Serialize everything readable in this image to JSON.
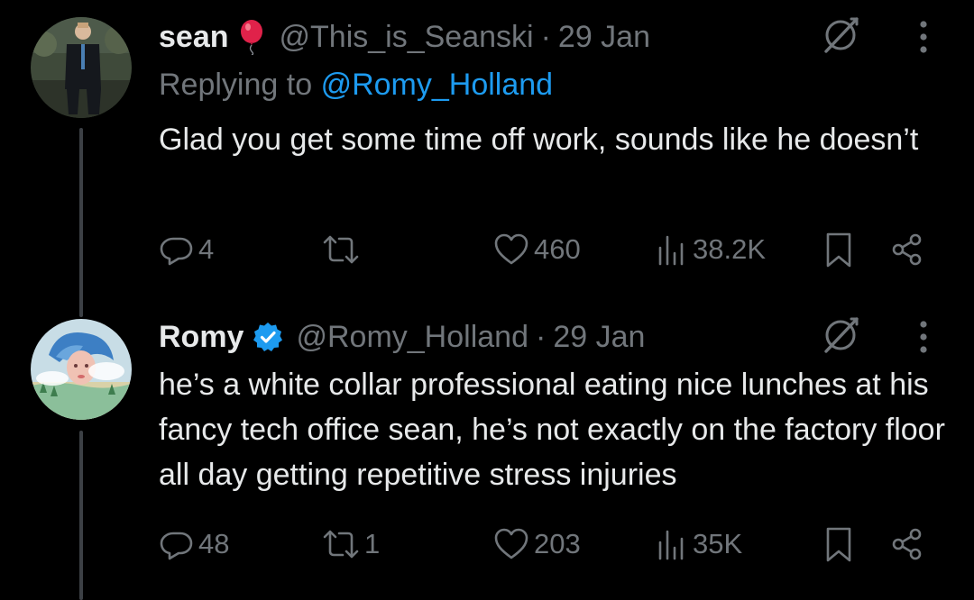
{
  "tweets": [
    {
      "display_name": "sean",
      "name_emoji": "balloon",
      "handle": "@This_is_Seanski",
      "separator": "·",
      "date": "29 Jan",
      "replying_prefix": "Replying to",
      "replying_to": "@Romy_Holland",
      "text": "Glad you get some time off work, sounds like he doesn’t",
      "reply_count": "4",
      "retweet_count": "",
      "like_count": "460",
      "view_count": "38.2K"
    },
    {
      "display_name": "Romy",
      "verified": true,
      "handle": "@Romy_Holland",
      "separator": "·",
      "date": "29 Jan",
      "text": "he’s a white collar professional eating nice lunches at his fancy tech office sean, he’s not exactly on the factory floor all day getting repetitive stress injuries",
      "reply_count": "48",
      "retweet_count": "1",
      "like_count": "203",
      "view_count": "35K"
    }
  ],
  "icons": {
    "reply": "reply-icon",
    "retweet": "retweet-icon",
    "like": "heart-icon",
    "views": "views-icon",
    "bookmark": "bookmark-icon",
    "share": "share-icon",
    "grok": "grok-icon",
    "more": "more-icon",
    "verified": "verified-badge-icon",
    "emoji": "balloon-emoji"
  },
  "colors": {
    "background": "#000000",
    "text": "#e7e9ea",
    "secondary": "#71767b",
    "accent": "#1d9bf0",
    "thread_line": "#3c4045",
    "balloon": "#e0224a"
  }
}
